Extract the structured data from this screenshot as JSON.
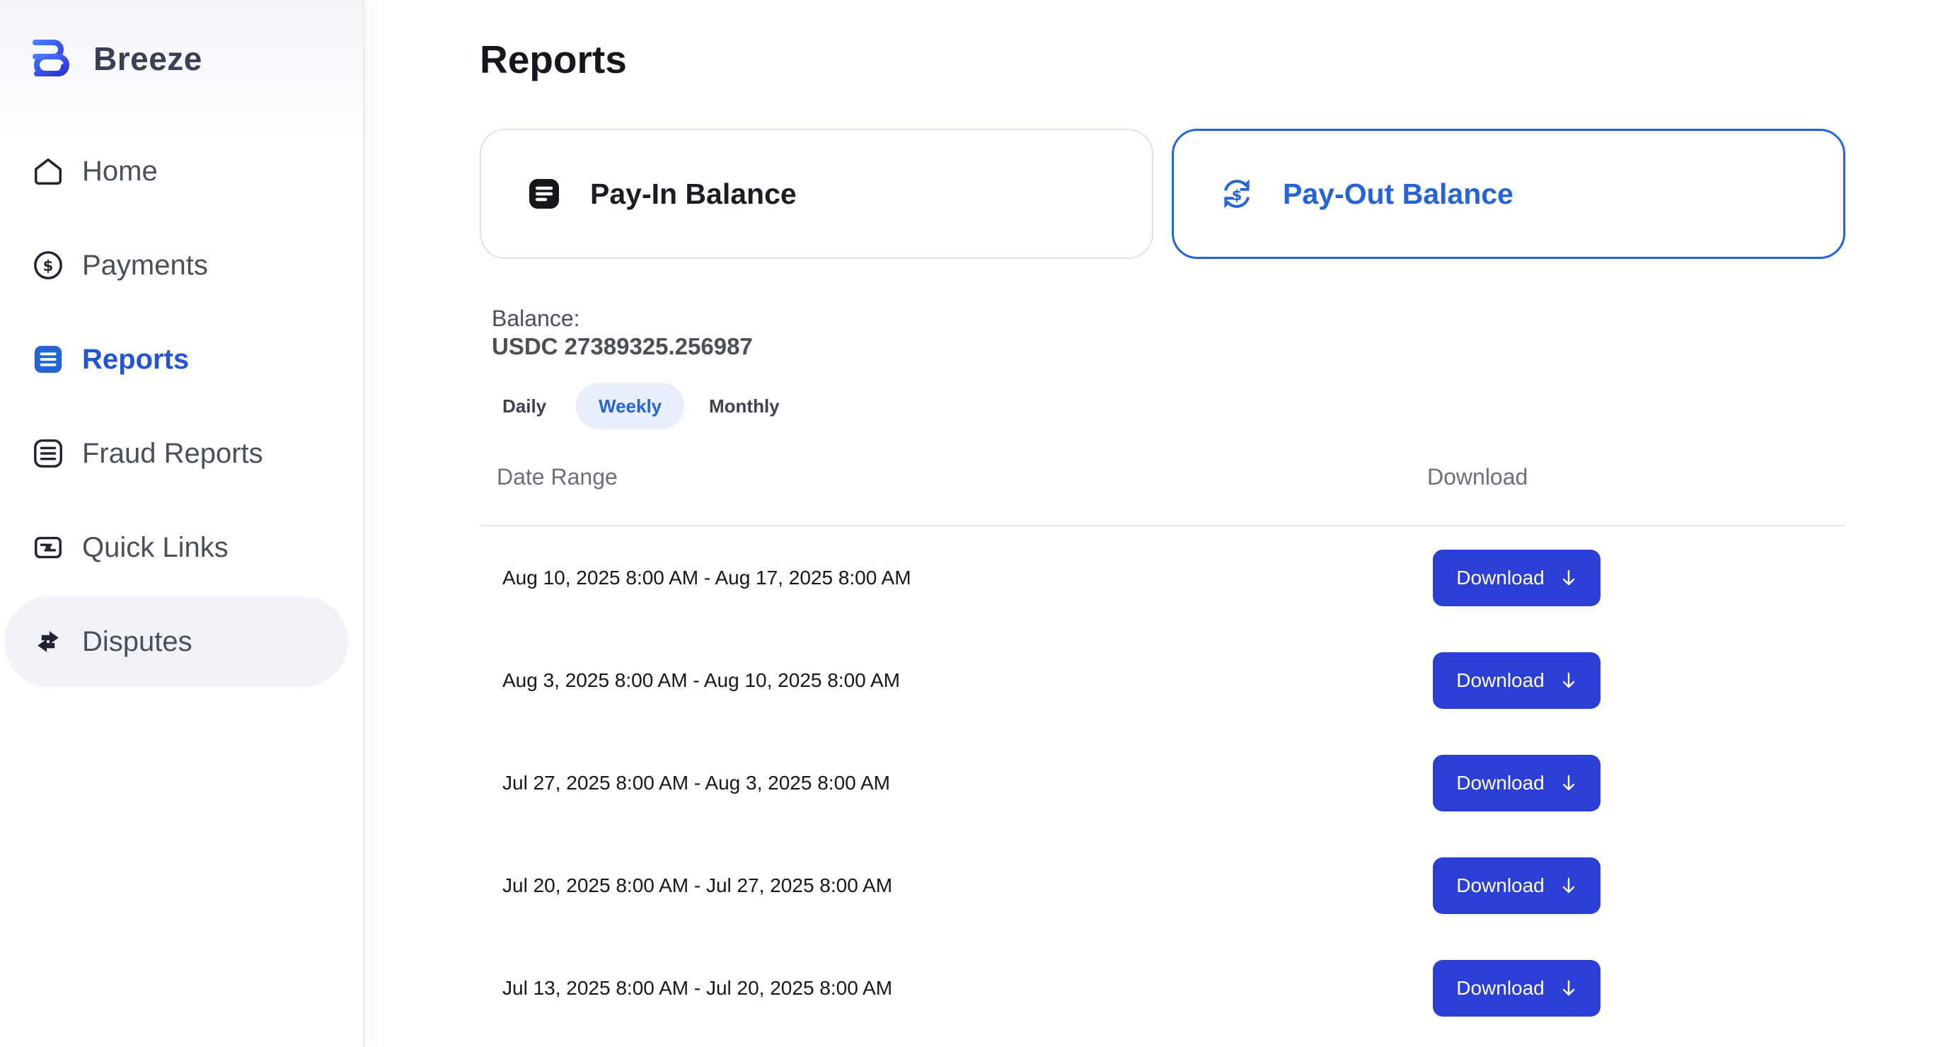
{
  "brand": {
    "name": "Breeze",
    "logo_icon": "breeze-logo-icon"
  },
  "sidebar": {
    "items": [
      {
        "label": "Home",
        "icon": "home-icon",
        "active": false
      },
      {
        "label": "Payments",
        "icon": "dollar-circle-icon",
        "active": false
      },
      {
        "label": "Reports",
        "icon": "list-icon",
        "active": true
      },
      {
        "label": "Fraud Reports",
        "icon": "list-outline-icon",
        "active": false
      },
      {
        "label": "Quick Links",
        "icon": "link-card-icon",
        "active": false
      },
      {
        "label": "Disputes",
        "icon": "swap-arrows-icon",
        "active": false
      }
    ]
  },
  "page": {
    "title": "Reports"
  },
  "balance_cards": [
    {
      "label": "Pay-In Balance",
      "icon": "list-square-icon",
      "selected": false
    },
    {
      "label": "Pay-Out Balance",
      "icon": "dollar-refresh-icon",
      "selected": true
    }
  ],
  "balance": {
    "label": "Balance:",
    "value": "USDC 27389325.256987"
  },
  "period_tabs": [
    {
      "label": "Daily",
      "active": false
    },
    {
      "label": "Weekly",
      "active": true
    },
    {
      "label": "Monthly",
      "active": false
    }
  ],
  "table": {
    "columns": [
      "Date Range",
      "Download"
    ],
    "rows": [
      {
        "range": "Aug 10, 2025 8:00 AM - Aug 17, 2025 8:00 AM",
        "button": "Download"
      },
      {
        "range": "Aug 3, 2025 8:00 AM - Aug 10, 2025 8:00 AM",
        "button": "Download"
      },
      {
        "range": "Jul 27, 2025 8:00 AM - Aug 3, 2025 8:00 AM",
        "button": "Download"
      },
      {
        "range": "Jul 20, 2025 8:00 AM - Jul 27, 2025 8:00 AM",
        "button": "Download"
      },
      {
        "range": "Jul 13, 2025 8:00 AM - Jul 20, 2025 8:00 AM",
        "button": "Download"
      }
    ]
  },
  "colors": {
    "accent": "#2563d8",
    "button": "#2b3fd4",
    "active_tab_bg": "#e6effb",
    "hover_bg": "#f2f3f8"
  }
}
